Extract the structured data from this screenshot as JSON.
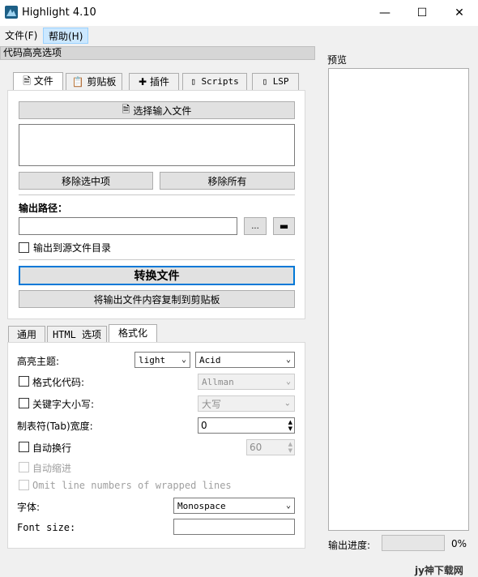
{
  "window": {
    "title": "Highlight 4.10",
    "minimize_glyph": "—",
    "maximize_glyph": "☐",
    "close_glyph": "✕"
  },
  "menu": {
    "file": "文件(F)",
    "help": "帮助(H)"
  },
  "section_title": "代码高亮选项",
  "top_tabs": [
    {
      "label": "文件",
      "icon": "file-icon"
    },
    {
      "label": "剪贴板",
      "icon": "clipboard-icon"
    },
    {
      "label": "插件",
      "icon": "puzzle-icon"
    },
    {
      "label": "Scripts",
      "icon": "script-icon"
    },
    {
      "label": "LSP",
      "icon": "script-icon"
    }
  ],
  "file_tab": {
    "select_input": "选择输入文件",
    "remove_selected": "移除选中项",
    "remove_all": "移除所有",
    "output_path_label": "输出路径：",
    "output_path_value": "",
    "browse_label": "...",
    "output_to_source_label": "输出到源文件目录",
    "convert_label": "转换文件",
    "copy_clipboard_label": "将输出文件内容复制到剪贴板"
  },
  "bottom_tabs": [
    "通用",
    "HTML 选项",
    "格式化"
  ],
  "format_tab": {
    "theme_label": "高亮主题:",
    "theme_value": "light",
    "theme_name": "Acid",
    "format_code_label": "格式化代码:",
    "format_style": "Allman",
    "keyword_case_label": "关键字大小写:",
    "keyword_case": "大写",
    "tab_width_label": "制表符(Tab)宽度:",
    "tab_width": "0",
    "auto_wrap_label": "自动换行",
    "wrap_width": "60",
    "auto_indent_label": "自动缩进",
    "omit_line_numbers_label": "Omit line numbers of wrapped lines",
    "font_label": "字体:",
    "font_value": "Monospace",
    "font_size_label": "Font size:",
    "font_size_value": ""
  },
  "preview": {
    "label": "预览"
  },
  "progress": {
    "label": "输出进度:",
    "percent_text": "0%",
    "value": 0
  },
  "watermark": "jy神下载网",
  "colors": {
    "accent": "#0078d7",
    "menu_highlight": "#cce8ff"
  }
}
